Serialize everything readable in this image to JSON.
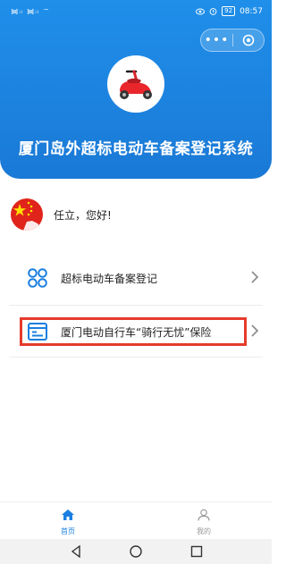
{
  "status_bar": {
    "left_text": "᯼ᵢₗ ᯼ᵢₗ ⌔",
    "clock": "08:57",
    "battery": "92"
  },
  "header": {
    "title": "厦门岛外超标电动车备案登记系统",
    "capsule_more": "•••",
    "brand_color": "#1a7fd9"
  },
  "user": {
    "greeting": "任立，您好!"
  },
  "menu": {
    "items": [
      {
        "label": "超标电动车备案登记",
        "icon": "grid-circles-icon"
      },
      {
        "label": "厦门电动自行车“骑行无忧”保险",
        "icon": "form-document-icon"
      }
    ]
  },
  "tabbar": {
    "home_label": "首页",
    "mine_label": "我的",
    "active_color": "#1a7fe0"
  },
  "highlight_color": "#e53b2c"
}
